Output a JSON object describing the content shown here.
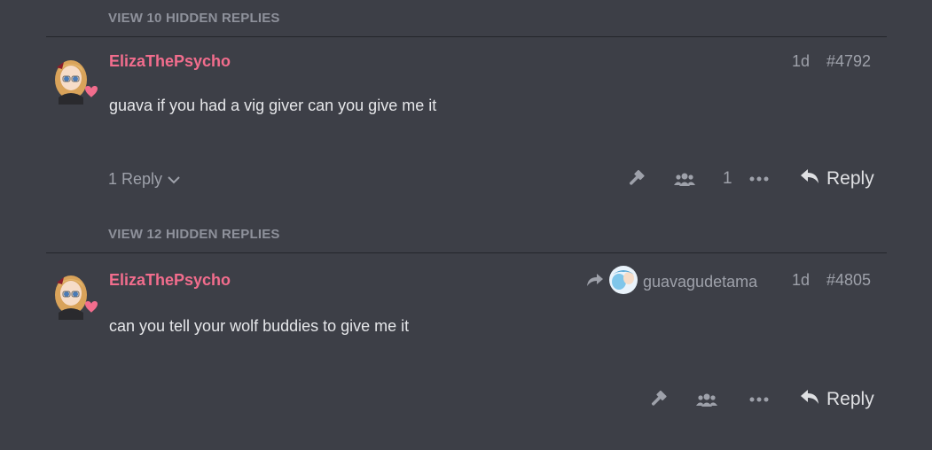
{
  "hidden_replies_1": {
    "label": "VIEW 10 HIDDEN REPLIES"
  },
  "post1": {
    "username": "ElizaThePsycho",
    "age": "1d",
    "number": "#4792",
    "body": "guava if you had a vig giver can you give me it",
    "replies_toggle": "1 Reply",
    "like_count": "1",
    "reply_label": "Reply"
  },
  "hidden_replies_2": {
    "label": "VIEW 12 HIDDEN REPLIES"
  },
  "post2": {
    "username": "ElizaThePsycho",
    "reply_to_user": "guavagudetama",
    "age": "1d",
    "number": "#4805",
    "body": "can you tell your wolf buddies to give me it",
    "reply_label": "Reply"
  },
  "colors": {
    "background": "#3d3f47",
    "username": "#f26d8d",
    "muted": "#9ea1aa",
    "text": "#e6e7ea"
  }
}
